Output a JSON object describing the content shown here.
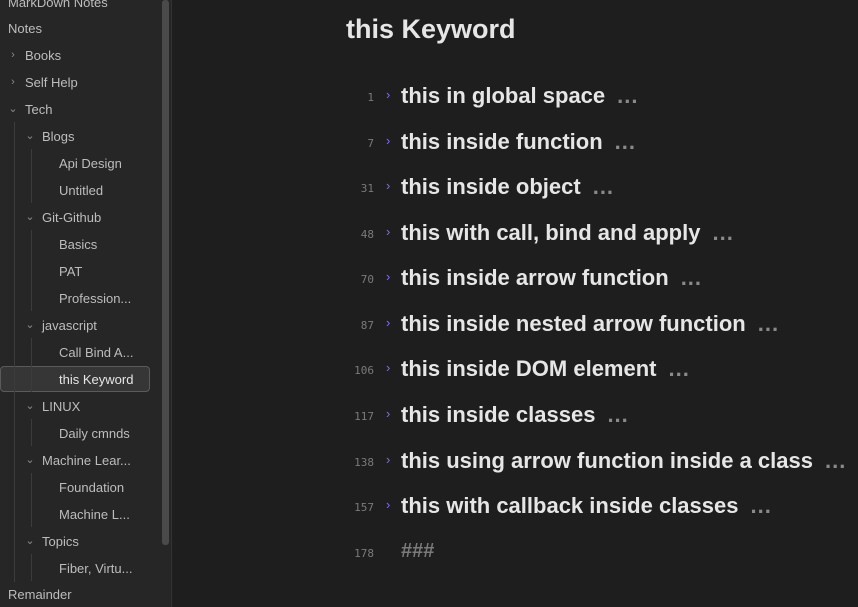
{
  "sidebar": {
    "vault_name": "MarkDown Notes",
    "items": [
      {
        "label": "Notes"
      },
      {
        "label": "Books"
      },
      {
        "label": "Self Help"
      },
      {
        "label": "Tech"
      },
      {
        "label": "Blogs"
      },
      {
        "label": "Api Design"
      },
      {
        "label": "Untitled"
      },
      {
        "label": "Git-Github"
      },
      {
        "label": "Basics"
      },
      {
        "label": "PAT"
      },
      {
        "label": "Profession..."
      },
      {
        "label": "javascript"
      },
      {
        "label": "Call Bind A..."
      },
      {
        "label": "this Keyword"
      },
      {
        "label": "LINUX"
      },
      {
        "label": "Daily cmnds"
      },
      {
        "label": "Machine Lear..."
      },
      {
        "label": "Foundation"
      },
      {
        "label": "Machine L..."
      },
      {
        "label": "Topics"
      },
      {
        "label": "Fiber, Virtu..."
      },
      {
        "label": "Remainder"
      }
    ]
  },
  "editor": {
    "title": "this Keyword",
    "ellipsis": "...",
    "headings": [
      {
        "line": "1",
        "text": "this in global space"
      },
      {
        "line": "7",
        "text": "this inside function"
      },
      {
        "line": "31",
        "text": "this inside object"
      },
      {
        "line": "48",
        "text": "this with call, bind and apply"
      },
      {
        "line": "70",
        "text": "this inside arrow function"
      },
      {
        "line": "87",
        "text": "this inside nested arrow function"
      },
      {
        "line": "106",
        "text": "this inside DOM element"
      },
      {
        "line": "117",
        "text": "this inside classes"
      },
      {
        "line": "138",
        "text": "this using arrow function inside a class"
      },
      {
        "line": "157",
        "text": "this with callback inside classes"
      }
    ],
    "last_line": {
      "line": "178",
      "text": "###"
    }
  }
}
